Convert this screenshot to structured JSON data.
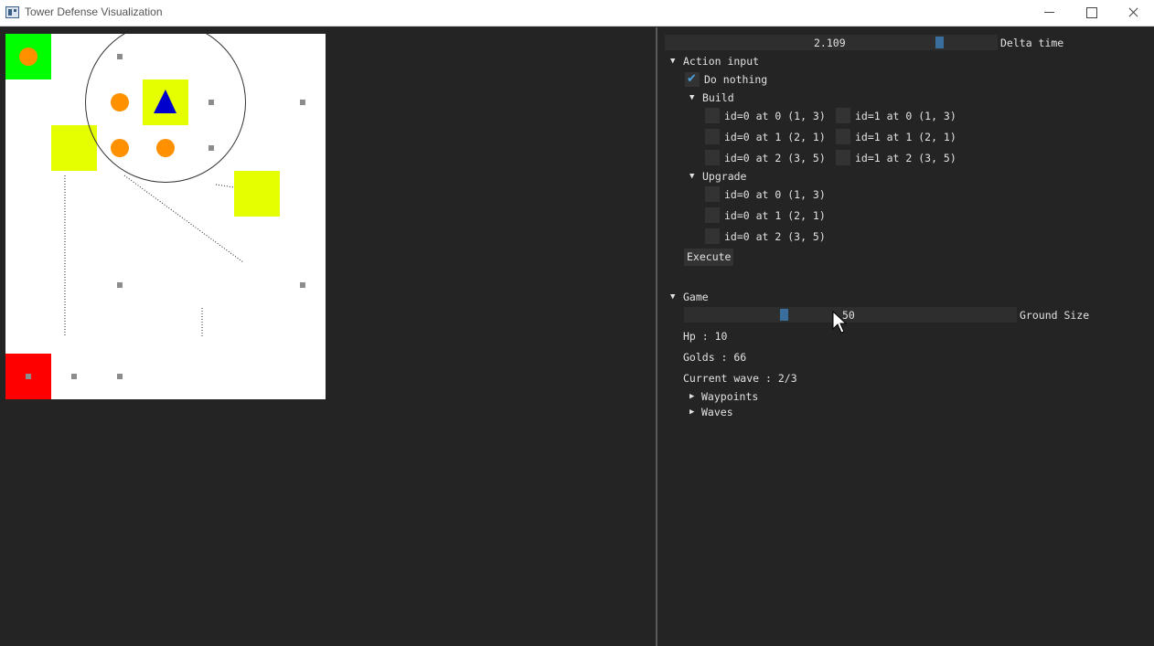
{
  "window": {
    "title": "Tower Defense Visualization"
  },
  "delta_time": {
    "value": "2.109",
    "label": "Delta time"
  },
  "action_input": {
    "header": "Action input",
    "do_nothing": {
      "label": "Do nothing",
      "checked": true
    },
    "build": {
      "header": "Build",
      "rows": [
        [
          "id=0 at 0 (1, 3)",
          "id=1 at 0 (1, 3)"
        ],
        [
          "id=0 at 1 (2, 1)",
          "id=1 at 1 (2, 1)"
        ],
        [
          "id=0 at 2 (3, 5)",
          "id=1 at 2 (3, 5)"
        ]
      ]
    },
    "upgrade": {
      "header": "Upgrade",
      "items": [
        "id=0 at 0 (1, 3)",
        "id=0 at 1 (2, 1)",
        "id=0 at 2 (3, 5)"
      ]
    },
    "execute_label": "Execute"
  },
  "game": {
    "header": "Game",
    "ground_size": {
      "value": "50",
      "label": "Ground Size"
    },
    "hp": "Hp : 10",
    "golds": "Golds : 66",
    "current_wave": "Current wave : 2/3",
    "waypoints_label": "Waypoints",
    "waves_label": "Waves"
  },
  "colors": {
    "spawn_tile": "#00ff00",
    "base_tile": "#ff0000",
    "tower_tile": "#e5ff00",
    "tower_icon": "#0000cc",
    "enemy": "#ff9100",
    "accent": "#3a6e9c",
    "panel_bg": "#242424"
  },
  "icons": {
    "tower": "triangle-icon",
    "enemy": "circle-icon",
    "waypoint": "square-icon"
  }
}
